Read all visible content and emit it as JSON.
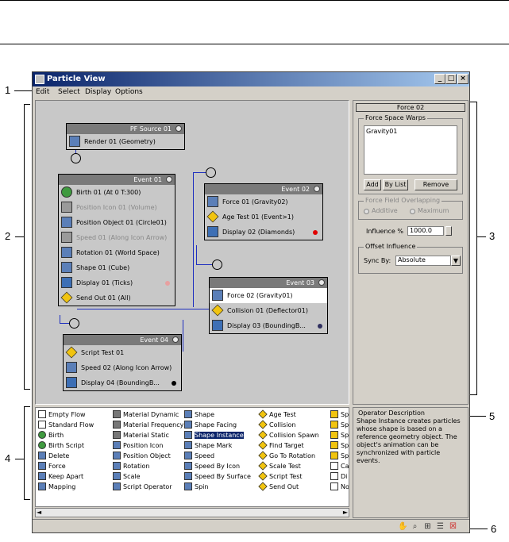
{
  "window": {
    "title": "Particle View",
    "menu": [
      "Edit",
      "Select",
      "Display",
      "Options"
    ],
    "controls": [
      "_",
      "□",
      "×"
    ]
  },
  "callouts": [
    "1",
    "2",
    "3",
    "4",
    "5",
    "6"
  ],
  "graph": {
    "nodes": [
      {
        "name": "PF Source 01",
        "ops": [
          {
            "label": "Render 01 (Geometry)",
            "icon": "render-icon"
          }
        ]
      },
      {
        "name": "Event 01",
        "ops": [
          {
            "label": "Birth 01 (At 0 T:300)",
            "icon": "birth-icon"
          },
          {
            "label": "Position Icon 01 (Volume)",
            "icon": "position-icon",
            "disabled": true
          },
          {
            "label": "Position Object 01 (Circle01)",
            "icon": "position-object-icon"
          },
          {
            "label": "Speed 01 (Along Icon Arrow)",
            "icon": "speed-icon",
            "disabled": true
          },
          {
            "label": "Rotation 01 (World Space)",
            "icon": "rotation-icon"
          },
          {
            "label": "Shape 01 (Cube)",
            "icon": "shape-icon"
          },
          {
            "label": "Display 01 (Ticks)",
            "icon": "display-icon",
            "dot": "#e8a0a0"
          },
          {
            "label": "Send Out 01 (All)",
            "icon": "send-out-icon"
          }
        ]
      },
      {
        "name": "Event 02",
        "ops": [
          {
            "label": "Force 01 (Gravity02)",
            "icon": "force-icon"
          },
          {
            "label": "Age Test 01 (Event>1)",
            "icon": "age-test-icon"
          },
          {
            "label": "Display 02 (Diamonds)",
            "icon": "display-icon",
            "dot": "#e00000"
          }
        ]
      },
      {
        "name": "Event 03",
        "ops": [
          {
            "label": "Force 02 (Gravity01)",
            "icon": "force-icon",
            "selected": true
          },
          {
            "label": "Collision 01 (Deflector01)",
            "icon": "collision-icon"
          },
          {
            "label": "Display 03 (BoundingB...",
            "icon": "display-icon",
            "dot": "#303060"
          }
        ]
      },
      {
        "name": "Event 04",
        "ops": [
          {
            "label": "Script Test 01",
            "icon": "script-test-icon"
          },
          {
            "label": "Speed 02 (Along Icon Arrow)",
            "icon": "speed-icon"
          },
          {
            "label": "Display 04 (BoundingB...",
            "icon": "display-icon",
            "dot": "#000000"
          }
        ]
      }
    ]
  },
  "params": {
    "rollout_title": "Force 02",
    "force_space_warps_label": "Force Space Warps",
    "force_list": [
      "Gravity01"
    ],
    "add_label": "Add",
    "by_list_label": "By List",
    "remove_label": "Remove",
    "overlapping_label": "Force Field Overlapping",
    "additive_label": "Additive",
    "maximum_label": "Maximum",
    "influence_label": "Influence %",
    "influence_value": "1000.0",
    "offset_label": "Offset Influence",
    "sync_by_label": "Sync By:",
    "sync_by_value": "Absolute"
  },
  "depot": {
    "columns": [
      [
        "Empty Flow",
        "Standard Flow",
        "Birth",
        "Birth Script",
        "Delete",
        "Force",
        "Keep Apart",
        "Mapping"
      ],
      [
        "Material Dynamic",
        "Material Frequency",
        "Material Static",
        "Position Icon",
        "Position Object",
        "Rotation",
        "Scale",
        "Script Operator"
      ],
      [
        "Shape",
        "Shape Facing",
        "Shape Instance",
        "Shape Mark",
        "Speed",
        "Speed By Icon",
        "Speed By Surface",
        "Spin"
      ],
      [
        "Age Test",
        "Collision",
        "Collision Spawn",
        "Find Target",
        "Go To Rotation",
        "Scale Test",
        "Script Test",
        "Send Out"
      ],
      [
        "Sp",
        "Sp",
        "Sp",
        "Sp",
        "Sp",
        "Ca",
        "Di",
        "No"
      ]
    ],
    "selected": "Shape Instance"
  },
  "description": {
    "title": "Operator Description",
    "text": "Shape Instance creates particles whose shape is based on a reference geometry object. The object's animation can be synchronized with particle events."
  },
  "status_tools": [
    "pan-icon",
    "zoom-icon",
    "zoom-region-icon",
    "zoom-extents-icon",
    "no-draw-icon"
  ]
}
